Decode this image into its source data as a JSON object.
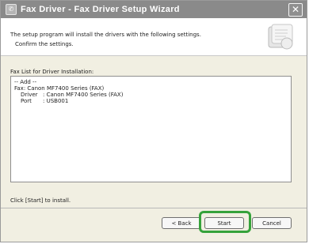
{
  "window": {
    "title": "Fax Driver - Fax Driver Setup Wizard",
    "close_label": "✕"
  },
  "header": {
    "line1": "The setup program will install the drivers with the following settings.",
    "line2": "Confirm the settings."
  },
  "list": {
    "label": "Fax List for Driver Installation:",
    "add_header": "-- Add --",
    "fax_line": "Fax: Canon MF7400 Series (FAX)",
    "driver_key": "Driver",
    "driver_value": ": Canon MF7400 Series (FAX)",
    "port_key": "Port",
    "port_value": ": USB001"
  },
  "hint": "Click [Start] to install.",
  "buttons": {
    "back": "< Back",
    "start": "Start",
    "cancel": "Cancel"
  },
  "colors": {
    "titlebar": "#8a8a8a",
    "dialog_bg": "#f1efe2",
    "highlight": "#35a23b"
  },
  "icons": {
    "title": "fax-app-icon",
    "close": "close-icon",
    "header_art": "installer-graphic"
  }
}
